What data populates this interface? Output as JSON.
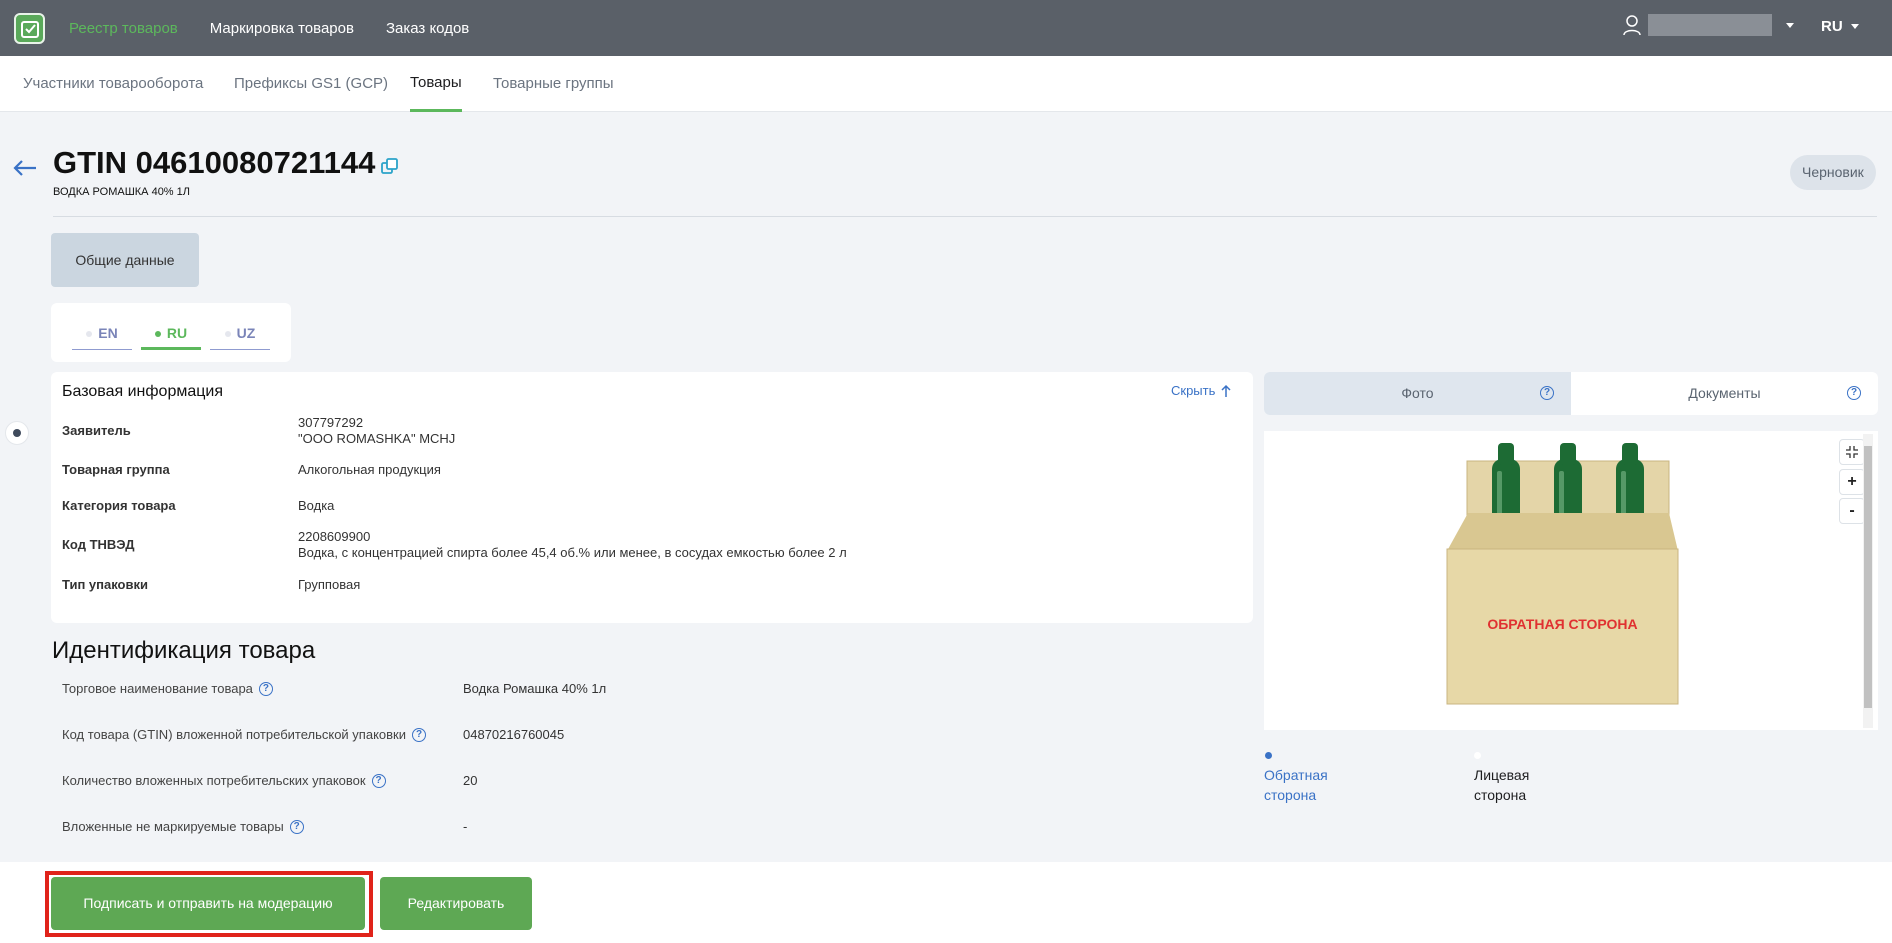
{
  "topbar": {
    "nav": [
      "Реестр товаров",
      "Маркировка товаров",
      "Заказ кодов"
    ],
    "lang": "RU"
  },
  "subnav": [
    "Участники товарооборота",
    "Префиксы GS1 (GCP)",
    "Товары",
    "Товарные группы"
  ],
  "header": {
    "title": "GTIN 04610080721144",
    "subtitle": "ВОДКА РОМАШКА 40% 1Л",
    "status": "Черновик"
  },
  "general_tab": "Общие данные",
  "lang_tabs": [
    "EN",
    "RU",
    "UZ"
  ],
  "base_info": {
    "title": "Базовая информация",
    "hide": "Скрыть",
    "rows": [
      {
        "label": "Заявитель",
        "value1": "307797292",
        "value2": "\"OOO ROMASHKA\" MCHJ"
      },
      {
        "label": "Товарная группа",
        "value1": "Алкогольная продукция"
      },
      {
        "label": "Категория товара",
        "value1": "Водка"
      },
      {
        "label": "Код ТНВЭД",
        "value1": "2208609900",
        "value2": "Водка, с концентрацией спирта более 45,4 об.% или менее, в сосудах емкостью более 2 л"
      },
      {
        "label": "Тип упаковки",
        "value1": "Групповая"
      }
    ]
  },
  "identification": {
    "title": "Идентификация товара",
    "rows": [
      {
        "label": "Торговое наименование товара",
        "value": "Водка Ромашка 40% 1л"
      },
      {
        "label": "Код товара (GTIN) вложенной потребительской упаковки",
        "value": "04870216760045"
      },
      {
        "label": "Количество вложенных потребительских упаковок",
        "value": "20"
      },
      {
        "label": "Вложенные не маркируемые товары",
        "value": "-"
      }
    ]
  },
  "media": {
    "tabs": [
      "Фото",
      "Документы"
    ],
    "image_text": "ОБРАТНАЯ СТОРОНА",
    "zoom_in": "+",
    "zoom_out": "-",
    "thumbs": [
      {
        "line1": "Обратная",
        "line2": "сторона"
      },
      {
        "line1": "Лицевая",
        "line2": "сторона"
      }
    ]
  },
  "actions": {
    "sign": "Подписать и отправить на модерацию",
    "edit": "Редактировать"
  },
  "colors": {
    "topbar": "#5a6068",
    "accent_green": "#5cb85c",
    "link_blue": "#3a72c6",
    "highlight_red": "#e0231a"
  }
}
